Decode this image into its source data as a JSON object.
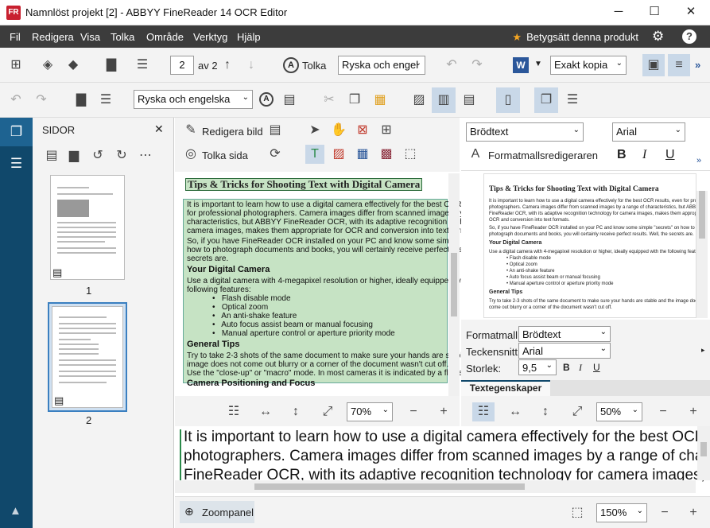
{
  "window": {
    "title": "Namnlöst projekt [2] - ABBYY FineReader 14 OCR Editor",
    "icon_label": "FR"
  },
  "menu": [
    "Fil",
    "Redigera",
    "Visa",
    "Tolka",
    "Område",
    "Verktyg",
    "Hjälp"
  ],
  "rate_label": "Betygsätt denna produkt",
  "toolbar1": {
    "page_current": "2",
    "page_of": "av 2",
    "recognize_label": "Tolka",
    "language": "Ryska och engel",
    "format": "Exakt kopia"
  },
  "toolbar2": {
    "language": "Ryska och engelska"
  },
  "pages_panel": {
    "title": "SIDOR",
    "thumb_labels": [
      "1",
      "2"
    ]
  },
  "image_tools": {
    "edit_image": "Redigera bild",
    "recognize_page": "Tolka sida"
  },
  "image_zoom": "70%",
  "text_zoom": "50%",
  "closeup_zoom": "150%",
  "zoom_panel_label": "Zoompanel",
  "text_tools": {
    "style": "Brödtext",
    "font": "Arial",
    "style_editor": "Formatmallsredigeraren",
    "bold": "B",
    "italic": "I",
    "underline": "U"
  },
  "properties": {
    "style_label": "Formatmall:",
    "style_value": "Brödtext",
    "font_label": "Teckensnitt:",
    "font_value": "Arial",
    "size_label": "Storlek:",
    "size_value": "9,5",
    "tab": "Textegenskaper"
  },
  "doc": {
    "title": "Tips & Tricks for Shooting Text with Digital Camera",
    "p1": "It is important to learn how to use a digital camera effectively for the best OCR results, even for professional photographers. Camera images differ from scanned images by a range of characteristics, but ABBYY FineReader OCR, with its adaptive recognition technology for camera images, makes them appropriate for OCR and conversion into text formats.",
    "p2": "So, if you have FineReader OCR installed on your PC and know some simple \"secrets\" on how to photograph documents and books, you will certainly receive perfect results. Well, the secrets are.",
    "h2": "Your Digital Camera",
    "p3": "Use a digital camera with 4-megapixel resolution or higher, ideally equipped with the following features:",
    "bullets": [
      "Flash disable mode",
      "Optical zoom",
      "An anti-shake feature",
      "Auto focus assist beam or manual focusing",
      "Manual aperture control or aperture priority mode"
    ],
    "h3": "General Tips",
    "p4": "Try to take 2-3 shots of the same document to make sure your hands are stable and the image does not come out blurry or a corner of the document wasn't cut off.",
    "p5": "Use the \"close-up\" or \"macro\" mode. In most cameras it is indicated by a flower icon.",
    "h4": "Camera Positioning and Focus"
  },
  "closeup_lines": [
    "It is important to learn how to use a digital camera effectively for the best OCR results, even for professional",
    "photographers. Camera images differ from scanned images by a range of characteristics, but ABBYY",
    "FineReader OCR, with its adaptive recognition technology for camera images, makes them appropriate"
  ],
  "accent": "#10486b",
  "highlight": "#c6e3c4"
}
